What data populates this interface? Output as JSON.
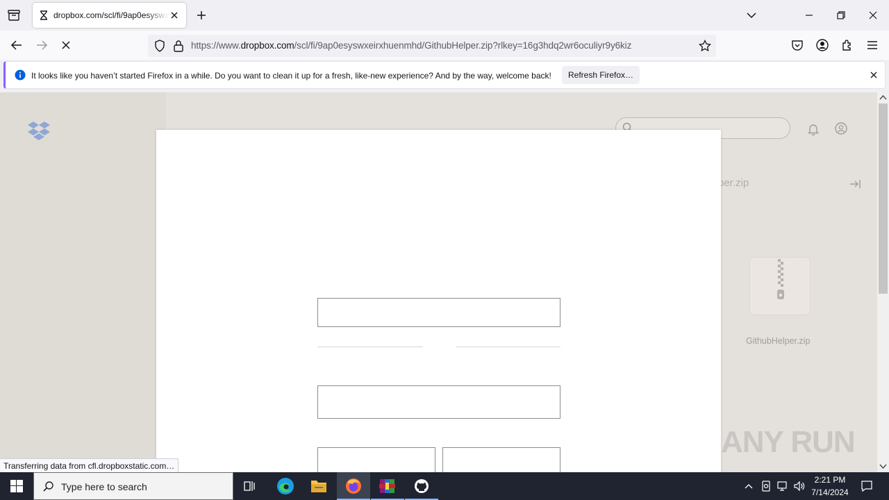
{
  "browser": {
    "tab": {
      "title": "dropbox.com/scl/fi/9ap0esyswxeirxhuenmhd/GithubHelper.zip"
    },
    "url": {
      "prefix": "https://www.",
      "domain": "dropbox.com",
      "path": "/scl/fi/9ap0esyswxeirxhuenmhd/GithubHelper.zip?rlkey=16g3hdq2wr6oculiyr9y6kiz"
    },
    "notification": {
      "message": "It looks like you haven’t started Firefox in a while. Do you want to clean it up for a fresh, like-new experience? And by the way, welcome back!",
      "button_label": "Refresh Firefox…"
    },
    "status_text": "Transferring data from cfl.dropboxstatic.com…"
  },
  "page": {
    "filename_partial": "per.zip",
    "file_label": "GithubHelper.zip",
    "watermark": "ANY RUN"
  },
  "taskbar": {
    "search_placeholder": "Type here to search",
    "time": "2:21 PM",
    "date": "7/14/2024"
  },
  "colors": {
    "accent": "#8f5bff",
    "dropbox_blue": "#0061fe",
    "taskbar": "#1f2430"
  }
}
